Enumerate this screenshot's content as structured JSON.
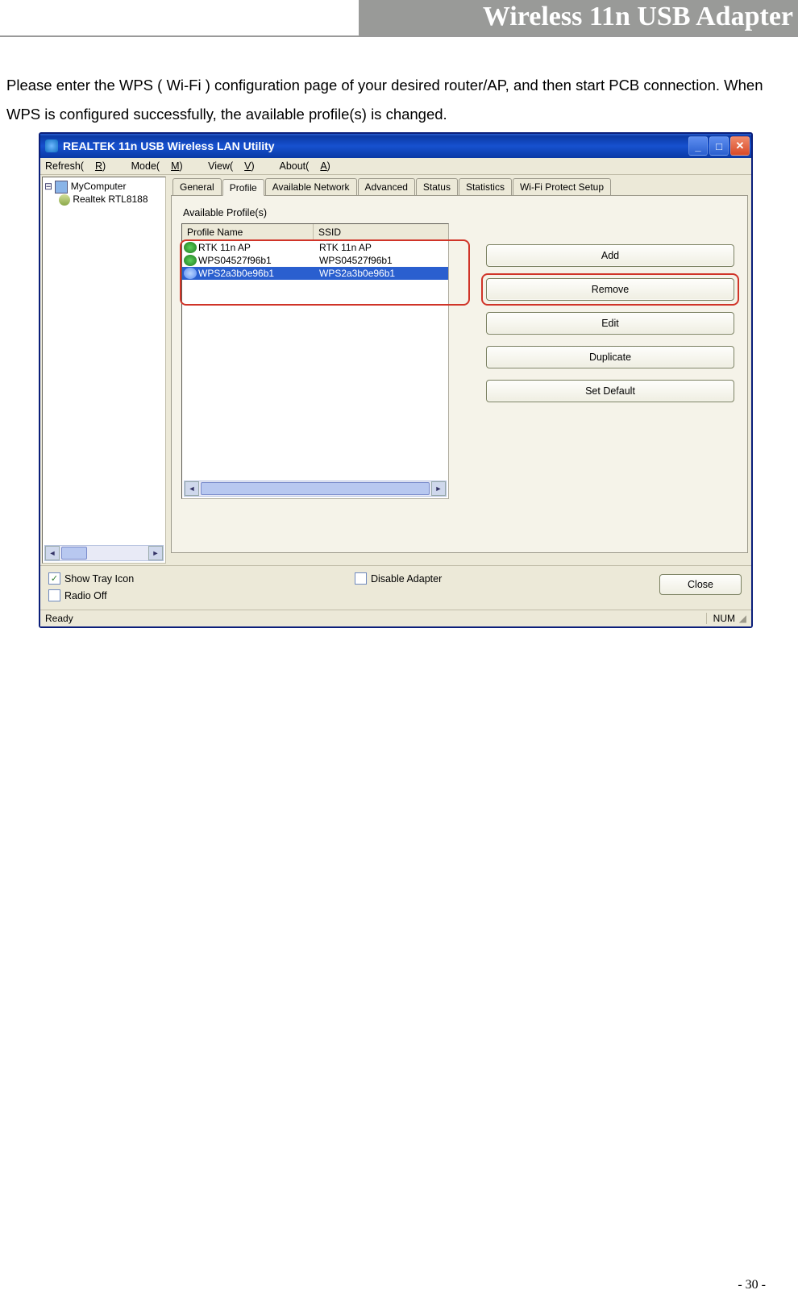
{
  "header": {
    "title": "Wireless 11n USB Adapter"
  },
  "intro": "Please enter the WPS ( Wi-Fi ) configuration page of your desired router/AP, and then start PCB connection. When WPS is configured successfully, the available profile(s) is changed.",
  "window": {
    "title": "REALTEK 11n USB Wireless LAN Utility",
    "menu": {
      "refresh": {
        "pre": "Refresh(",
        "u": "R",
        "post": ")"
      },
      "mode": {
        "pre": "Mode(",
        "u": "M",
        "post": ")"
      },
      "view": {
        "pre": "View(",
        "u": "V",
        "post": ")"
      },
      "about": {
        "pre": "About(",
        "u": "A",
        "post": ")"
      }
    },
    "tree": {
      "root": "MyComputer",
      "child": "Realtek RTL8188"
    },
    "tabs": [
      "General",
      "Profile",
      "Available Network",
      "Advanced",
      "Status",
      "Statistics",
      "Wi-Fi Protect Setup"
    ],
    "active_tab": 1,
    "section_label": "Available Profile(s)",
    "columns": {
      "name": "Profile Name",
      "ssid": "SSID"
    },
    "rows": [
      {
        "name": "RTK 11n AP",
        "ssid": "RTK 11n AP",
        "selected": false
      },
      {
        "name": "WPS04527f96b1",
        "ssid": "WPS04527f96b1",
        "selected": false
      },
      {
        "name": "WPS2a3b0e96b1",
        "ssid": "WPS2a3b0e96b1",
        "selected": true
      }
    ],
    "buttons": {
      "add": "Add",
      "remove": "Remove",
      "edit": "Edit",
      "duplicate": "Duplicate",
      "setdefault": "Set Default"
    },
    "checks": {
      "show_tray": "Show Tray Icon",
      "radio_off": "Radio Off",
      "disable_adapter": "Disable Adapter"
    },
    "close": "Close",
    "status": {
      "left": "Ready",
      "right": "NUM"
    }
  },
  "page_number": "- 30 -"
}
